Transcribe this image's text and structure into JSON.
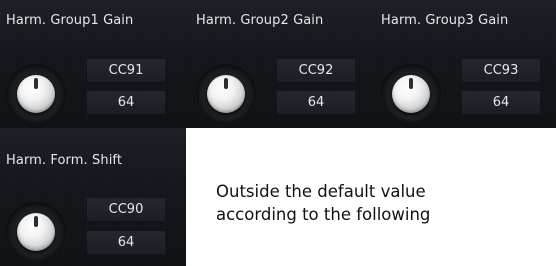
{
  "controls": [
    {
      "title": "Harm. Group1 Gain",
      "cc": "CC91",
      "value": "64"
    },
    {
      "title": "Harm. Group2 Gain",
      "cc": "CC92",
      "value": "64"
    },
    {
      "title": "Harm. Group3 Gain",
      "cc": "CC93",
      "value": "64"
    },
    {
      "title": "Harm. Form. Shift",
      "cc": "CC90",
      "value": "64"
    }
  ],
  "document_text": {
    "line1": "Outside the default value",
    "line2": "according to the following"
  }
}
